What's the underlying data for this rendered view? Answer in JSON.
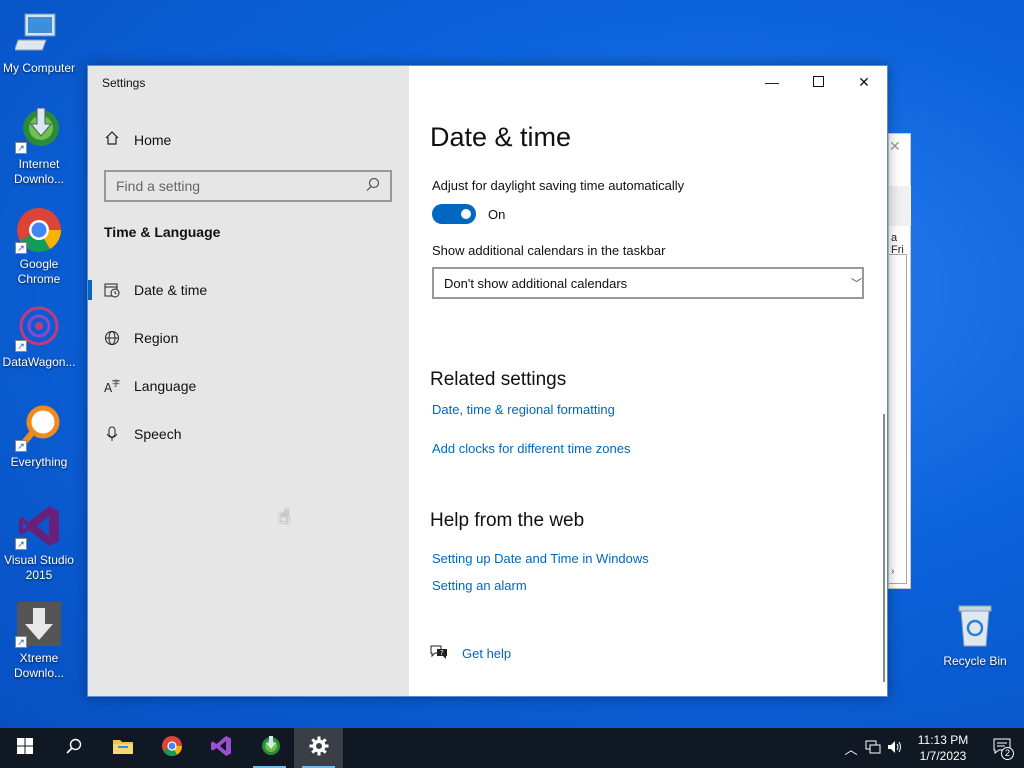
{
  "desktop": {
    "icons": [
      {
        "label": "My Computer"
      },
      {
        "label": "Internet Downlo..."
      },
      {
        "label": "Google Chrome"
      },
      {
        "label": "DataWagon..."
      },
      {
        "label": "Everything"
      },
      {
        "label": "Visual Studio 2015"
      },
      {
        "label": "Xtreme Downlo..."
      }
    ],
    "recycle_bin": "Recycle Bin",
    "background_window_text": "a Fri"
  },
  "settings": {
    "window_title": "Settings",
    "nav": {
      "home": "Home",
      "search_placeholder": "Find a setting",
      "section": "Time & Language",
      "items": [
        {
          "label": "Date & time",
          "icon": "clock-calendar-icon",
          "active": true
        },
        {
          "label": "Region",
          "icon": "globe-icon",
          "active": false
        },
        {
          "label": "Language",
          "icon": "language-icon",
          "active": false
        },
        {
          "label": "Speech",
          "icon": "microphone-icon",
          "active": false
        }
      ]
    },
    "main": {
      "title": "Date & time",
      "dst_label": "Adjust for daylight saving time automatically",
      "dst_state": "On",
      "calendars_label": "Show additional calendars in the taskbar",
      "calendars_value": "Don't show additional calendars",
      "related_heading": "Related settings",
      "related_links": [
        "Date, time & regional formatting",
        "Add clocks for different time zones"
      ],
      "help_heading": "Help from the web",
      "help_links": [
        "Setting up Date and Time in Windows",
        "Setting an alarm"
      ],
      "get_help": "Get help"
    }
  },
  "taskbar": {
    "time": "11:13 PM",
    "date": "1/7/2023",
    "notification_count": "2"
  },
  "colors": {
    "accent": "#0067c0",
    "taskbar": "#101823",
    "desktop": "#0b63dc"
  }
}
